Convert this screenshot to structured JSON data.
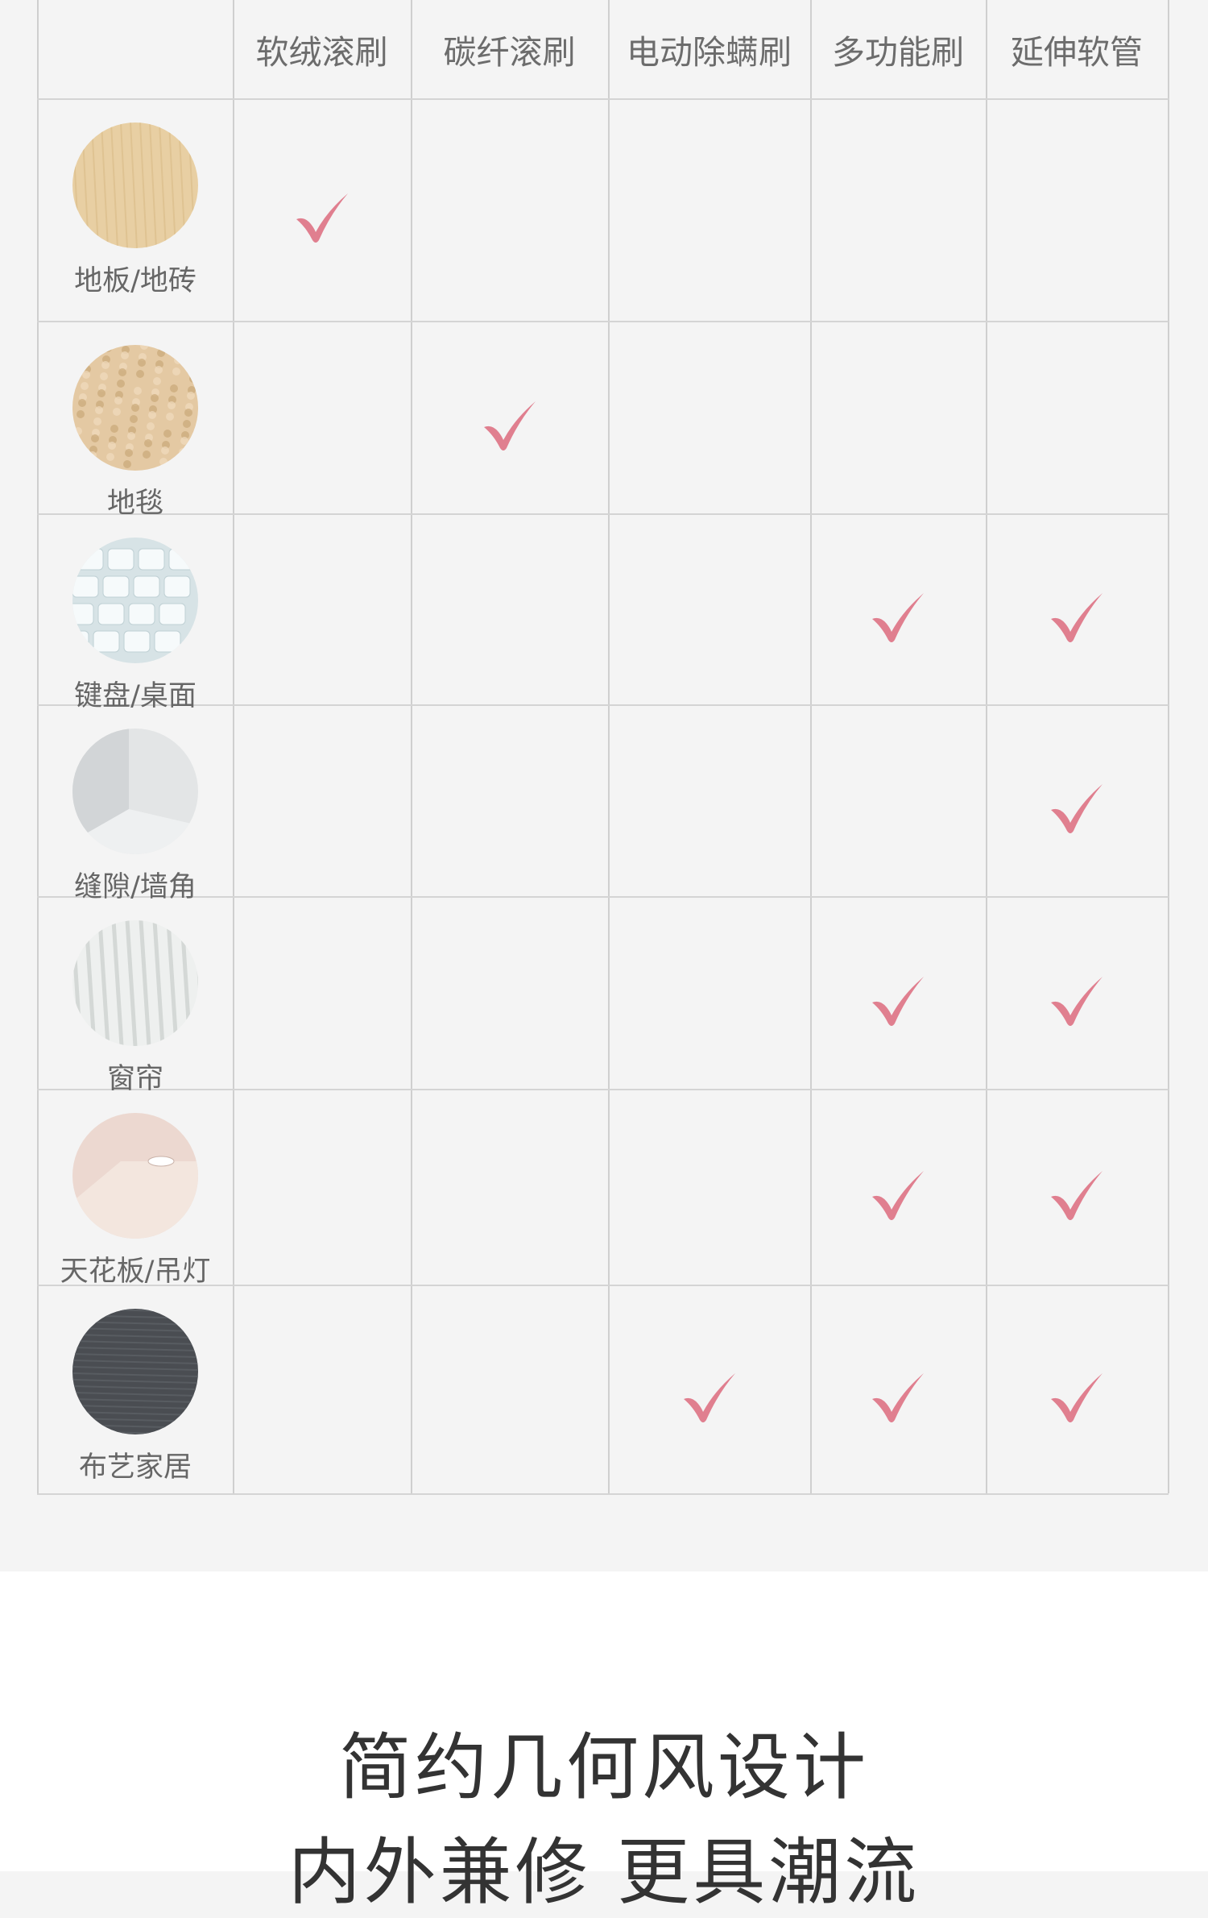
{
  "table": {
    "columns": [
      "软绒滚刷",
      "碳纤滚刷",
      "电动除螨刷",
      "多功能刷",
      "延伸软管"
    ],
    "rows": [
      {
        "label": "地板/地砖",
        "thumb": "wood-floor",
        "checks": [
          true,
          false,
          false,
          false,
          false
        ]
      },
      {
        "label": "地毯",
        "thumb": "carpet",
        "checks": [
          false,
          true,
          false,
          false,
          false
        ]
      },
      {
        "label": "键盘/桌面",
        "thumb": "keyboard",
        "checks": [
          false,
          false,
          false,
          true,
          true
        ]
      },
      {
        "label": "缝隙/墙角",
        "thumb": "wall-corner",
        "checks": [
          false,
          false,
          false,
          false,
          true
        ]
      },
      {
        "label": "窗帘",
        "thumb": "curtain",
        "checks": [
          false,
          false,
          false,
          true,
          true
        ]
      },
      {
        "label": "天花板/吊灯",
        "thumb": "ceiling-light",
        "checks": [
          false,
          false,
          false,
          true,
          true
        ]
      },
      {
        "label": "布艺家居",
        "thumb": "fabric",
        "checks": [
          false,
          false,
          true,
          true,
          true
        ]
      }
    ]
  },
  "design": {
    "title_line1": "简约几何风设计",
    "title_line2": "内外兼修 更具潮流"
  },
  "colors": {
    "check": "#e07f8f",
    "grid_line": "#cfcfcf",
    "background": "#f4f4f4"
  },
  "icons": {
    "check": "check-icon"
  }
}
